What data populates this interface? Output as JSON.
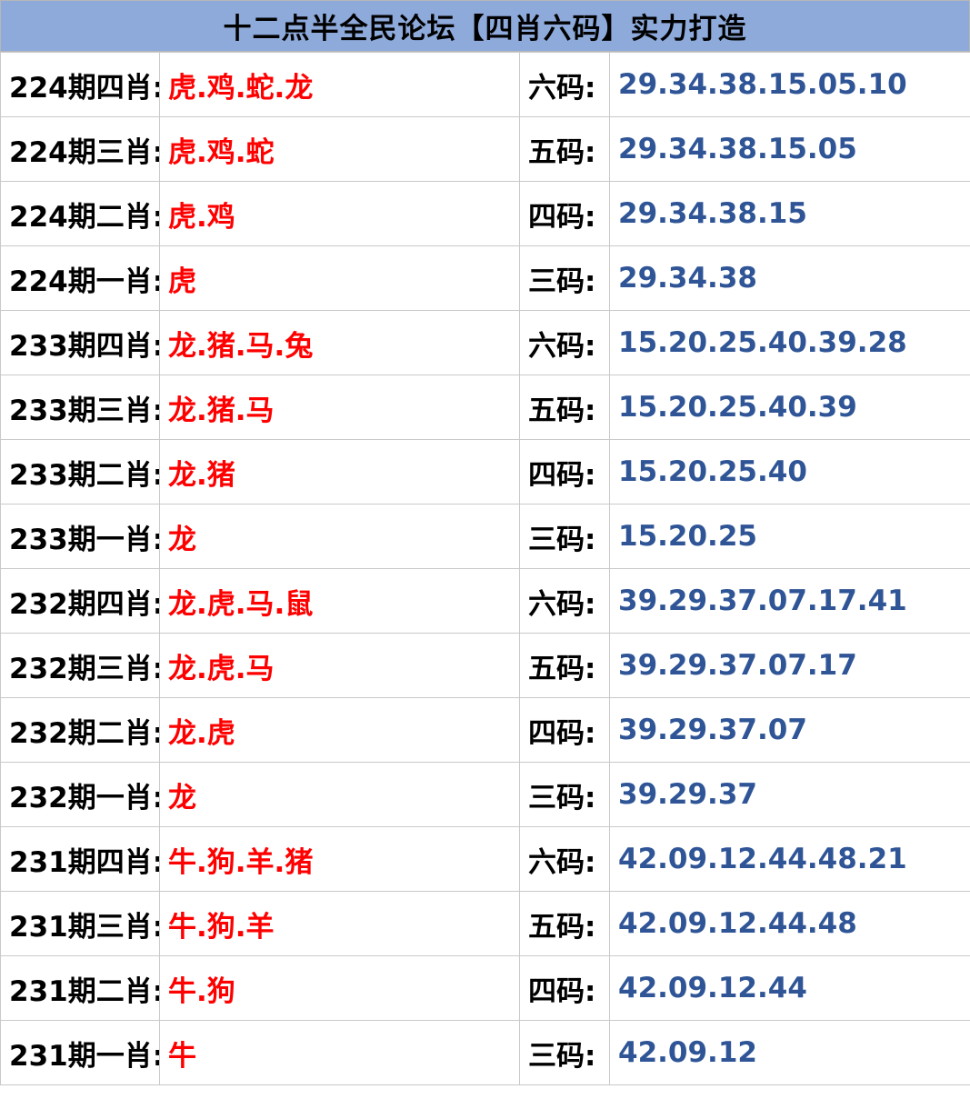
{
  "title": "十二点半全民论坛【四肖六码】实力打造",
  "colors": {
    "header_bg": "#8eaadb",
    "zodiac_text": "#ff0000",
    "code_text": "#2f5597",
    "label_text": "#000000"
  },
  "rows": [
    {
      "period": "224期四肖:",
      "zodiac": "虎.鸡.蛇.龙",
      "code_label": "六码:",
      "codes": "29.34.38.15.05.10"
    },
    {
      "period": "224期三肖:",
      "zodiac": "虎.鸡.蛇",
      "code_label": "五码:",
      "codes": "29.34.38.15.05"
    },
    {
      "period": "224期二肖:",
      "zodiac": "虎.鸡",
      "code_label": "四码:",
      "codes": "29.34.38.15"
    },
    {
      "period": "224期一肖:",
      "zodiac": "虎",
      "code_label": "三码:",
      "codes": "29.34.38"
    },
    {
      "period": "233期四肖:",
      "zodiac": "龙.猪.马.兔",
      "code_label": "六码:",
      "codes": "15.20.25.40.39.28"
    },
    {
      "period": "233期三肖:",
      "zodiac": "龙.猪.马",
      "code_label": "五码:",
      "codes": "15.20.25.40.39"
    },
    {
      "period": "233期二肖:",
      "zodiac": "龙.猪",
      "code_label": "四码:",
      "codes": "15.20.25.40"
    },
    {
      "period": "233期一肖:",
      "zodiac": "龙",
      "code_label": "三码:",
      "codes": "15.20.25"
    },
    {
      "period": "232期四肖:",
      "zodiac": "龙.虎.马.鼠",
      "code_label": "六码:",
      "codes": "39.29.37.07.17.41"
    },
    {
      "period": "232期三肖:",
      "zodiac": "龙.虎.马",
      "code_label": "五码:",
      "codes": "39.29.37.07.17"
    },
    {
      "period": "232期二肖:",
      "zodiac": "龙.虎",
      "code_label": "四码:",
      "codes": "39.29.37.07"
    },
    {
      "period": "232期一肖:",
      "zodiac": "龙",
      "code_label": "三码:",
      "codes": "39.29.37"
    },
    {
      "period": "231期四肖:",
      "zodiac": "牛.狗.羊.猪",
      "code_label": "六码:",
      "codes": "42.09.12.44.48.21"
    },
    {
      "period": "231期三肖:",
      "zodiac": "牛.狗.羊",
      "code_label": "五码:",
      "codes": "42.09.12.44.48"
    },
    {
      "period": "231期二肖:",
      "zodiac": "牛.狗",
      "code_label": "四码:",
      "codes": "42.09.12.44"
    },
    {
      "period": "231期一肖:",
      "zodiac": "牛",
      "code_label": "三码:",
      "codes": "42.09.12"
    }
  ]
}
